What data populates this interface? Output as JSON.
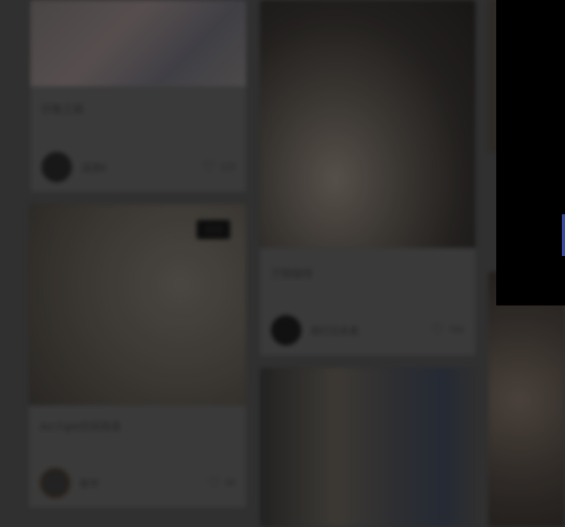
{
  "feed": {
    "cards": [
      {
        "title": "印象之城",
        "author": "逗游K",
        "likes": "123"
      },
      {
        "title": "",
        "author": "",
        "likes": "",
        "badge": "视频"
      },
      {
        "title": "Art Fight空间改造",
        "author": "新开",
        "likes": "58"
      },
      {
        "title": "万物咖啡",
        "author": "旅行日志者",
        "likes": "76K"
      },
      {
        "title": "",
        "author": "",
        "likes": ""
      }
    ]
  },
  "colors": {
    "page_bg": "#3b3b3b",
    "card_bg": "#474747",
    "popup_bg": "#000000",
    "accent": "#3a4aa0"
  }
}
